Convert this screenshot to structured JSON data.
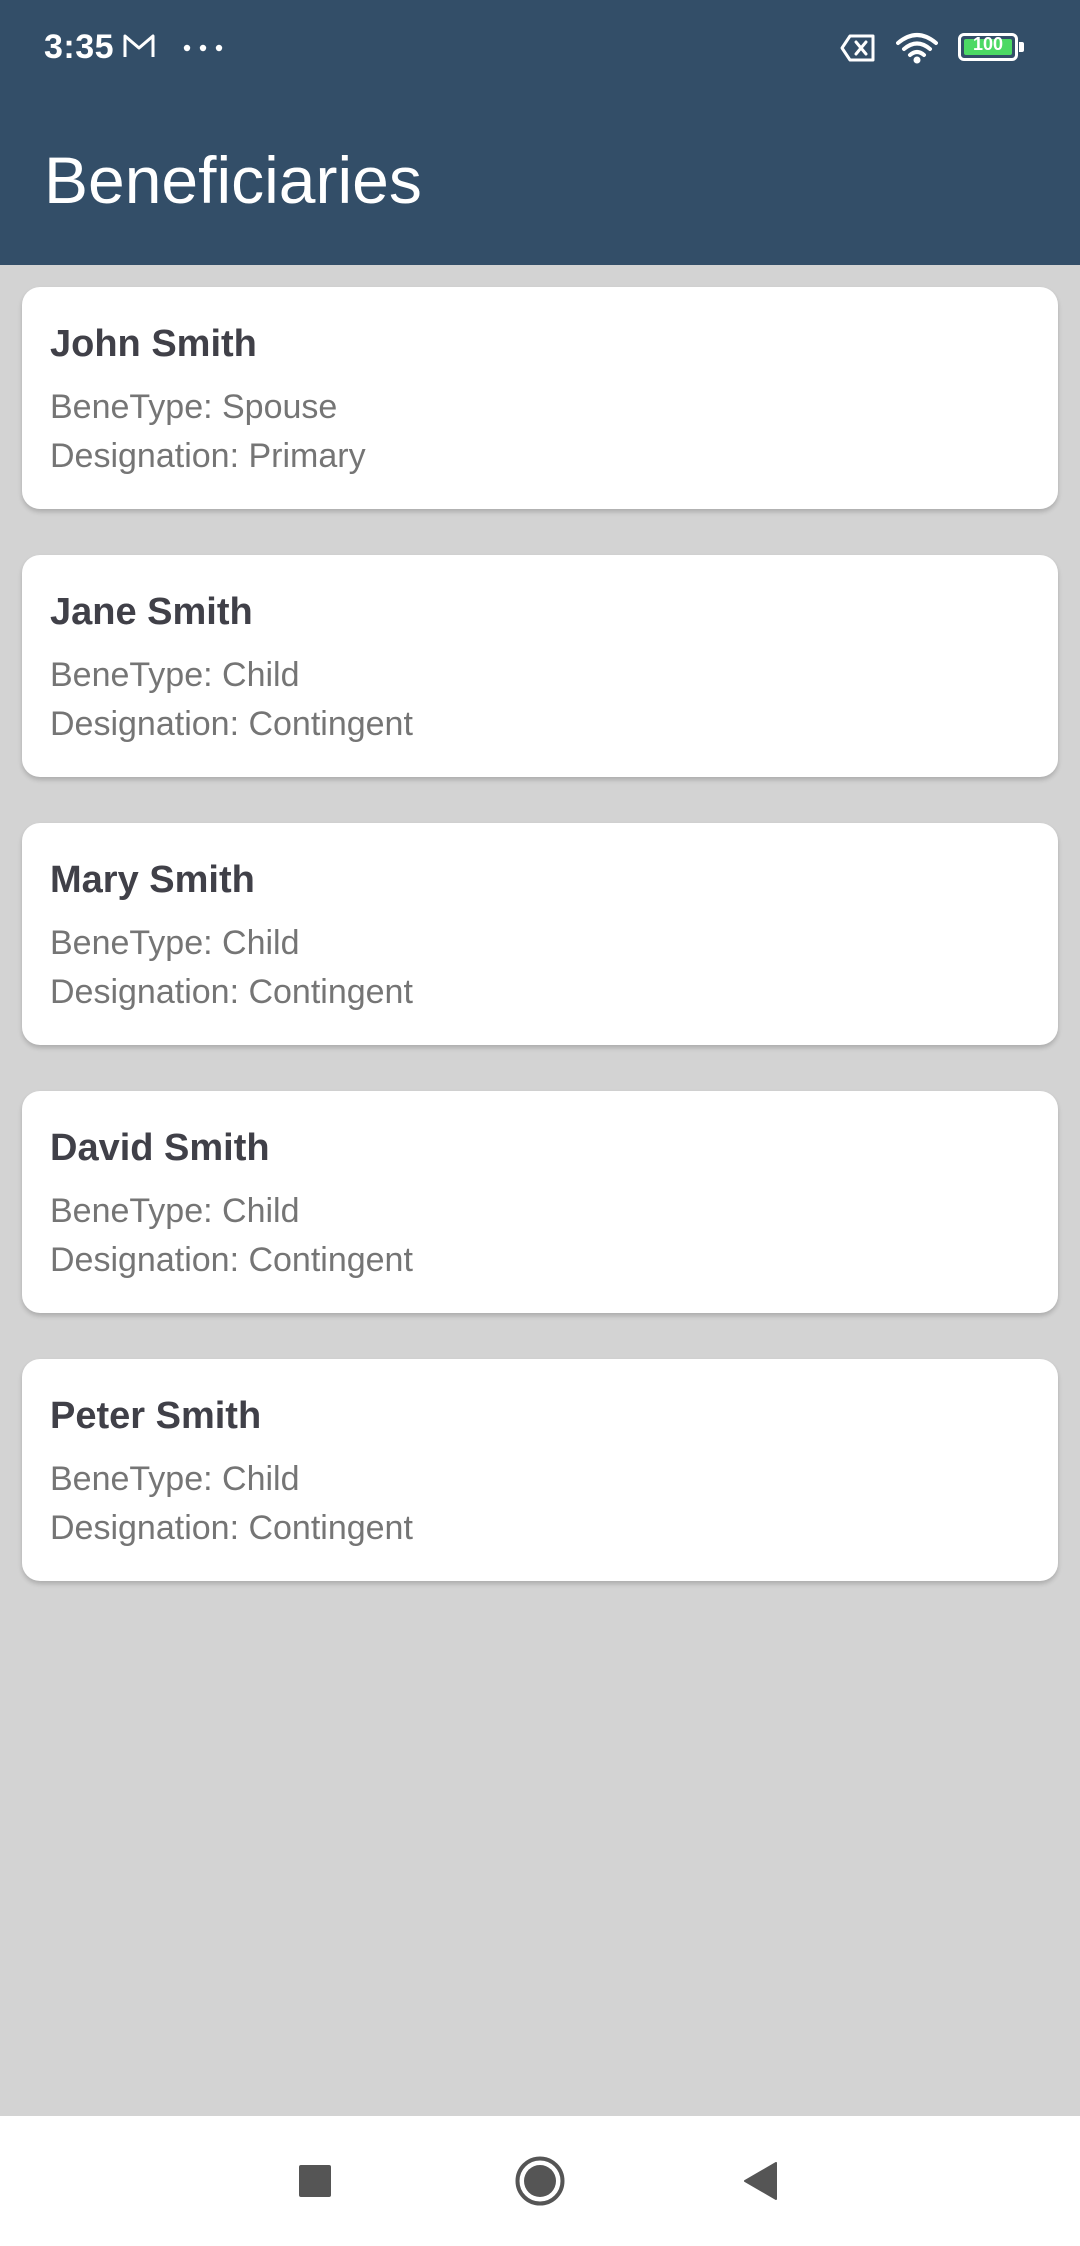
{
  "status_bar": {
    "time": "3:35",
    "icons": [
      "gmail-icon",
      "more-dots-icon",
      "no-sim-icon",
      "wifi-icon",
      "battery-icon"
    ],
    "battery_level": "100",
    "battery_color": "#4cd964"
  },
  "header": {
    "title": "Beneficiaries",
    "background": "#334e68"
  },
  "beneficiaries": [
    {
      "name": "John Smith",
      "bene_type": "BeneType: Spouse",
      "designation": "Designation: Primary"
    },
    {
      "name": "Jane Smith",
      "bene_type": "BeneType: Child",
      "designation": "Designation: Contingent"
    },
    {
      "name": "Mary Smith",
      "bene_type": "BeneType: Child",
      "designation": "Designation: Contingent"
    },
    {
      "name": "David Smith",
      "bene_type": "BeneType: Child",
      "designation": "Designation: Contingent"
    },
    {
      "name": "Peter Smith",
      "bene_type": "BeneType: Child",
      "designation": "Designation: Contingent"
    }
  ],
  "nav_bar": {
    "buttons": [
      "recents-square-icon",
      "home-circle-icon",
      "back-triangle-icon"
    ]
  }
}
